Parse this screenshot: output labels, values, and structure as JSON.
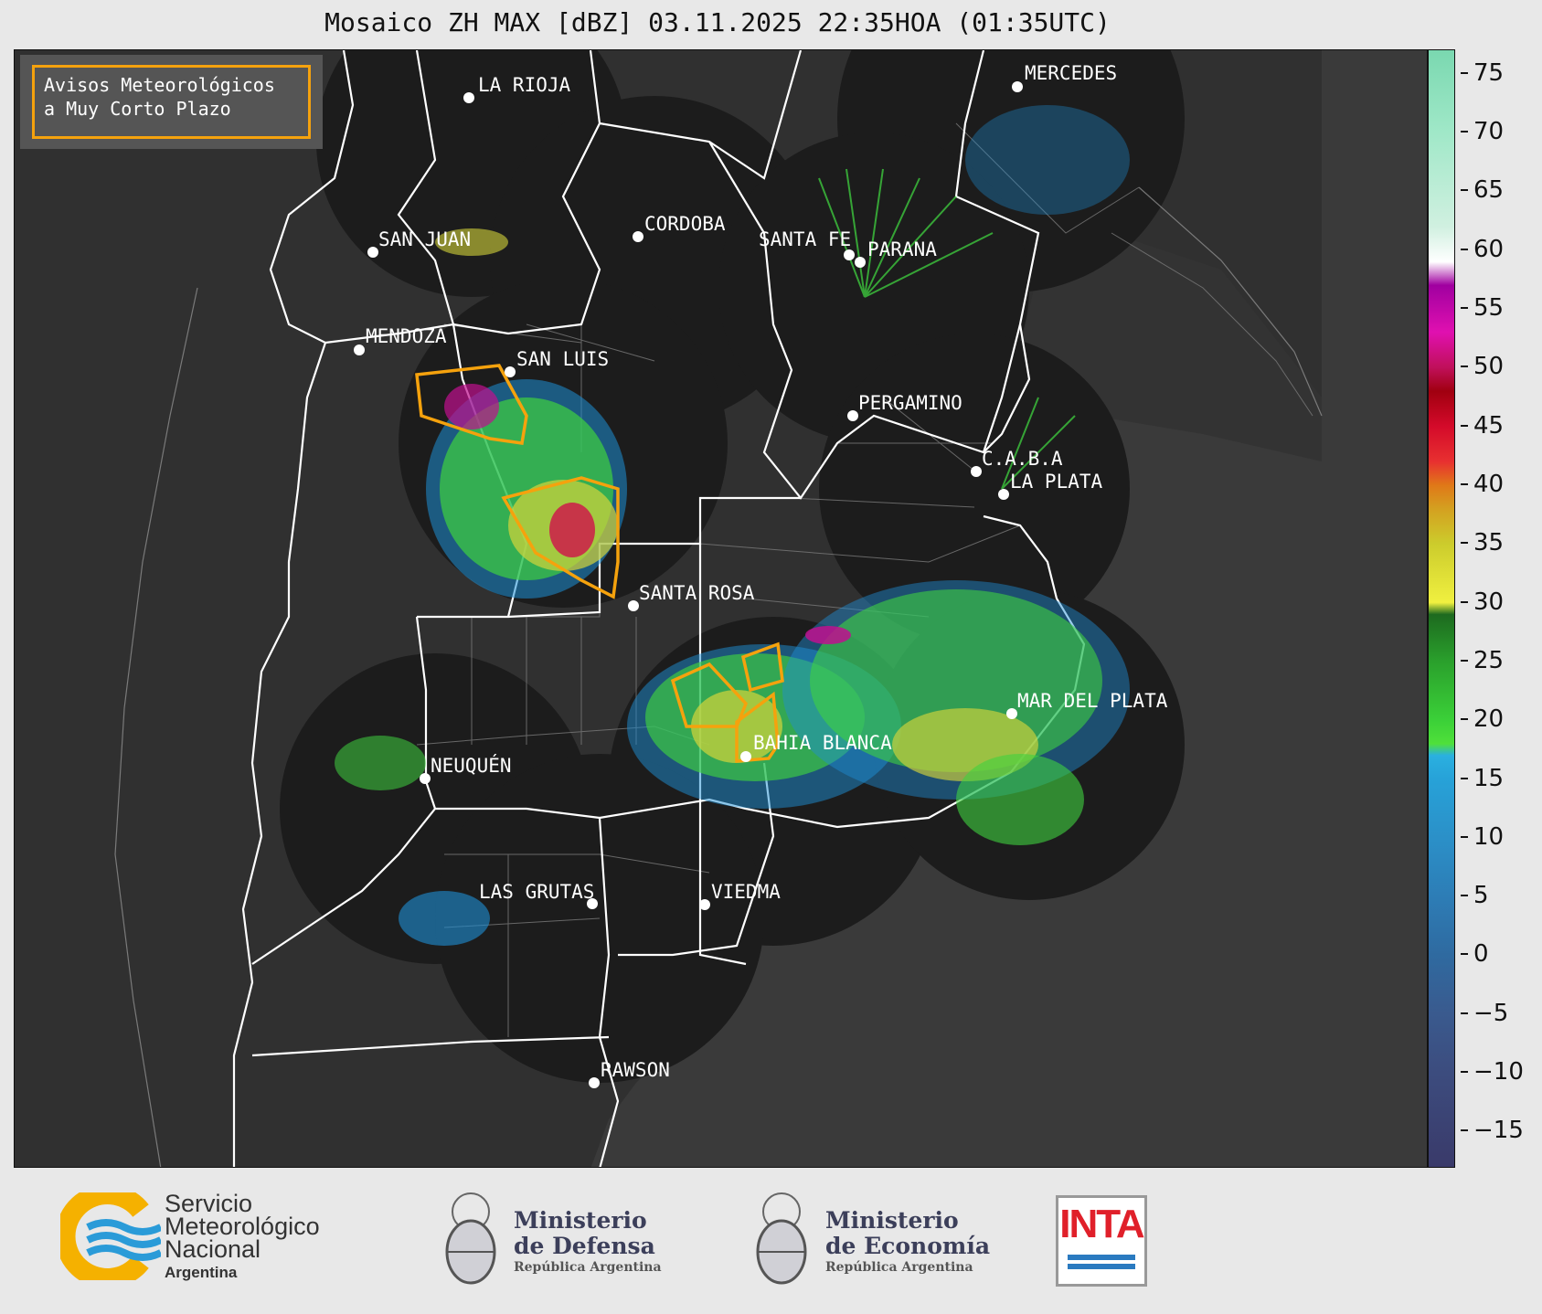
{
  "title": "Mosaico ZH MAX [dBZ] 03.11.2025 22:35HOA (01:35UTC)",
  "warning_box": {
    "line1": "Avisos Meteorológicos",
    "line2": "a Muy Corto Plazo"
  },
  "cities": [
    {
      "name": "LA RIOJA"
    },
    {
      "name": "MERCEDES"
    },
    {
      "name": "CORDOBA"
    },
    {
      "name": "SAN JUAN"
    },
    {
      "name": "SANTA FE"
    },
    {
      "name": "PARANA"
    },
    {
      "name": "MENDOZA"
    },
    {
      "name": "SAN LUIS"
    },
    {
      "name": "PERGAMINO"
    },
    {
      "name": "C.A.B.A"
    },
    {
      "name": "LA PLATA"
    },
    {
      "name": "SANTA ROSA"
    },
    {
      "name": "MAR DEL PLATA"
    },
    {
      "name": "BAHIA BLANCA"
    },
    {
      "name": "NEUQUÉN"
    },
    {
      "name": "LAS GRUTAS"
    },
    {
      "name": "VIEDMA"
    },
    {
      "name": "RAWSON"
    }
  ],
  "colorbar": {
    "unit": "dBZ",
    "min": -18,
    "max": 77,
    "ticks": [
      "75",
      "70",
      "65",
      "60",
      "55",
      "50",
      "45",
      "40",
      "35",
      "30",
      "25",
      "20",
      "15",
      "10",
      "5",
      "0",
      "−5",
      "−10",
      "−15"
    ],
    "tick_values": [
      75,
      70,
      65,
      60,
      55,
      50,
      45,
      40,
      35,
      30,
      25,
      20,
      15,
      10,
      5,
      0,
      -5,
      -10,
      -15
    ]
  },
  "colors": {
    "sea": "#3a3a3a",
    "land": "#2e2e2e",
    "radar_coverage": "#1c1c1c",
    "warning_polygon": "#f5a20d",
    "border_white": "#ffffff",
    "border_gray": "#8a8a8a"
  },
  "footer": {
    "smn_line1": "Servicio",
    "smn_line2": "Meteorológico",
    "smn_line3": "Nacional",
    "smn_line4": "Argentina",
    "defensa_line1": "Ministerio",
    "defensa_line2": "de Defensa",
    "defensa_sub": "República Argentina",
    "economia_line1": "Ministerio",
    "economia_line2": "de Economía",
    "economia_sub": "República Argentina",
    "inta": "INTA"
  }
}
